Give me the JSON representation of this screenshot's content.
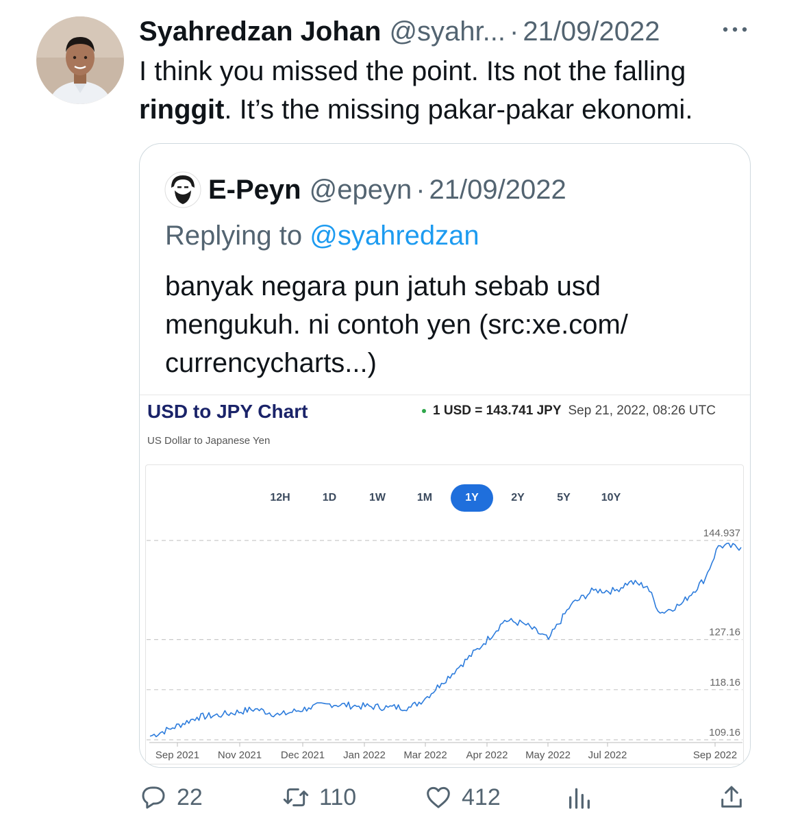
{
  "tweet": {
    "author_name": "Syahredzan Johan",
    "handle": "@syahr...",
    "separator": "·",
    "date": "21/09/2022",
    "text_before": "I think you missed the point. Its not the falling ",
    "text_bold": "ringgit",
    "text_after": ". It’s the missing pakar-pakar ekonomi."
  },
  "quote": {
    "author_name": "E-Peyn",
    "handle": "@epeyn",
    "separator": "·",
    "date": "21/09/2022",
    "replying_label": "Replying to ",
    "replying_mention": "@syahredzan",
    "text": "banyak negara pun jatuh sebab usd mengukuh. ni contoh yen (src:xe.com/ currencycharts...)"
  },
  "xe_card": {
    "title": "USD to JPY Chart",
    "subtitle": "US Dollar to Japanese Yen",
    "rate": "1 USD = 143.741 JPY",
    "timestamp": "Sep 21, 2022, 08:26 UTC",
    "ranges": [
      "12H",
      "1D",
      "1W",
      "1M",
      "1Y",
      "2Y",
      "5Y",
      "10Y"
    ],
    "active_range": "1Y",
    "colors": {
      "line": "#2b7bdc",
      "active": "#1f6fdc",
      "title": "#1a2369",
      "live": "#2ea64a"
    }
  },
  "chart_data": {
    "type": "line",
    "title": "USD to JPY Chart",
    "subtitle": "US Dollar to Japanese Yen",
    "x_tick_labels": [
      "Sep 2021",
      "Nov 2021",
      "Dec 2021",
      "Jan 2022",
      "Mar 2022",
      "Apr 2022",
      "May 2022",
      "Jul 2022",
      "Sep 2022"
    ],
    "y_tick_labels": [
      "109.16",
      "118.16",
      "127.16",
      "144.937"
    ],
    "ylim": [
      109.16,
      144.937
    ],
    "grid": "dashed horizontal",
    "series": [
      {
        "x": [
          "2021-09-21",
          "2021-10-05",
          "2021-10-20",
          "2021-11-05",
          "2021-11-25",
          "2021-12-10",
          "2021-12-28",
          "2022-01-10",
          "2022-01-28",
          "2022-02-15",
          "2022-03-01",
          "2022-03-10",
          "2022-03-20",
          "2022-04-01",
          "2022-04-15",
          "2022-04-28",
          "2022-05-10",
          "2022-05-25",
          "2022-06-08",
          "2022-06-22",
          "2022-07-05",
          "2022-07-14",
          "2022-07-25",
          "2022-08-02",
          "2022-08-15",
          "2022-08-30",
          "2022-09-07",
          "2022-09-21"
        ],
        "values": [
          109.8,
          111.3,
          113.2,
          113.7,
          114.7,
          113.6,
          114.9,
          115.6,
          115.2,
          115.0,
          115.0,
          116.6,
          119.3,
          122.6,
          126.4,
          130.6,
          130.0,
          127.2,
          133.4,
          136.0,
          135.9,
          137.5,
          136.7,
          131.9,
          133.5,
          138.2,
          144.0,
          143.7
        ]
      }
    ]
  },
  "actions": {
    "replies": "22",
    "retweets": "110",
    "likes": "412"
  },
  "icons": [
    "more-icon",
    "reply-icon",
    "retweet-icon",
    "like-icon",
    "views-icon",
    "share-icon"
  ]
}
